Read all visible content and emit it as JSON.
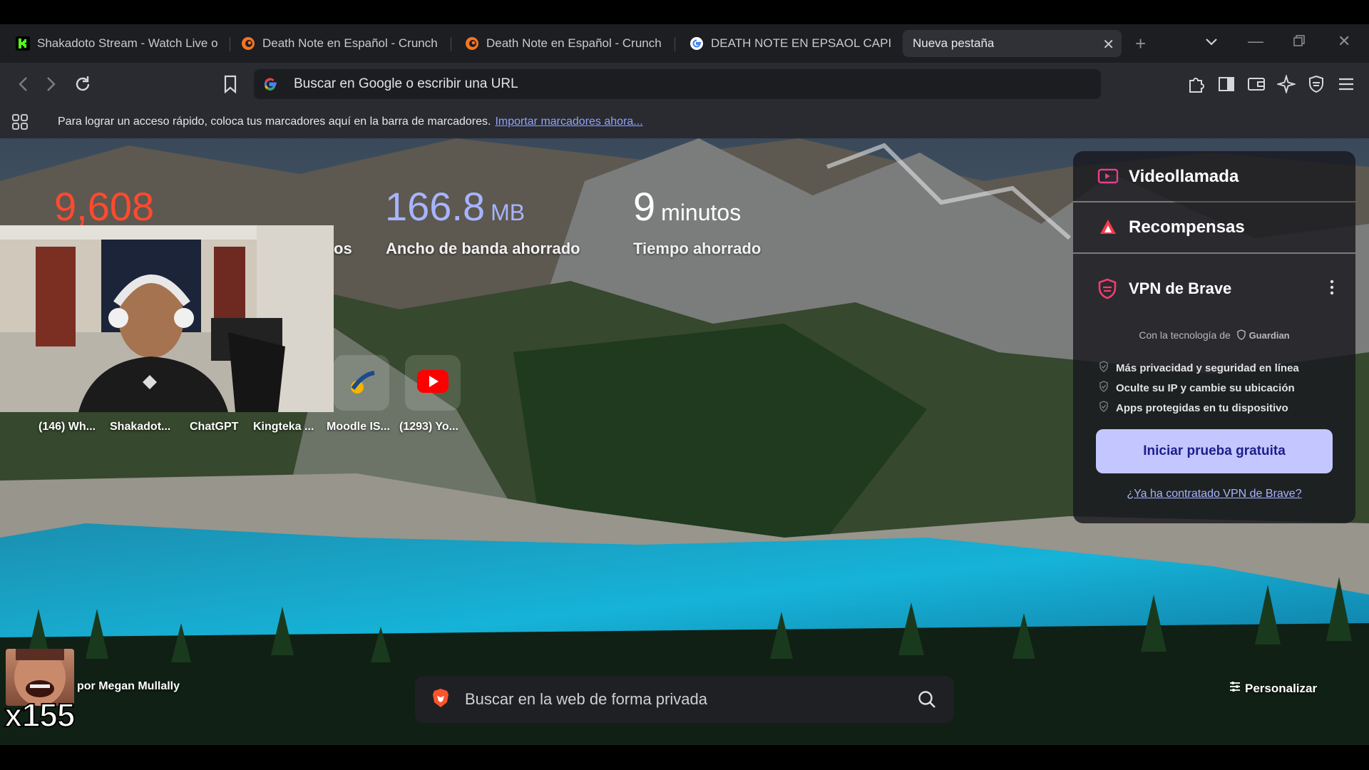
{
  "tabs": [
    {
      "title": "Shakadoto Stream - Watch Live o",
      "favicon": "kick-icon"
    },
    {
      "title": "Death Note en Español - Crunch",
      "favicon": "crunchyroll-icon"
    },
    {
      "title": "Death Note en Español - Crunch",
      "favicon": "crunchyroll-icon"
    },
    {
      "title": "DEATH NOTE EN EPSAOL CAPITR",
      "favicon": "google-icon"
    },
    {
      "title": "Nueva pestaña",
      "favicon": "none",
      "active": true
    }
  ],
  "omnibox": {
    "placeholder": "Buscar en Google o escribir una URL"
  },
  "bookmarks_bar": {
    "message": "Para lograr un acceso rápido, coloca tus marcadores aquí en la barra de marcadores.",
    "import_link": "Importar marcadores ahora..."
  },
  "stats": {
    "trackers": {
      "value": "9,608",
      "label_fragment": "os",
      "color": "#ff4a2e"
    },
    "bandwidth": {
      "value": "166.8",
      "unit": "MB",
      "label": "Ancho de banda ahorrado",
      "color": "#a7b4ff"
    },
    "time": {
      "value": "9",
      "unit": "minutos",
      "label": "Tiempo ahorrado"
    }
  },
  "top_sites": [
    {
      "label": "(146) Wh..."
    },
    {
      "label": "Shakadot..."
    },
    {
      "label": "ChatGPT"
    },
    {
      "label": "Kingteka ..."
    },
    {
      "label": "Moodle IS..."
    },
    {
      "label": "(1293) Yo..."
    }
  ],
  "widgets": {
    "videollamada": {
      "label": "Videollamada"
    },
    "recompensas": {
      "label": "Recompensas"
    },
    "vpn": {
      "title": "VPN de Brave",
      "powered_by": "Con la tecnología de",
      "partner": "Guardian",
      "features": [
        "Más privacidad y seguridad en línea",
        "Oculte su IP y cambie su ubicación",
        "Apps protegidas en tu dispositivo"
      ],
      "cta": "Iniciar prueba gratuita",
      "link": "¿Ya ha contratado VPN de Brave?"
    }
  },
  "search": {
    "placeholder": "Buscar en la web de forma privada"
  },
  "photo_credit": "por Megan Mullally",
  "customize": "Personalizar",
  "overlay": {
    "multiplier": "x155"
  },
  "colors": {
    "accent": "#c4c7ff",
    "brave_orange": "#fb542b"
  }
}
